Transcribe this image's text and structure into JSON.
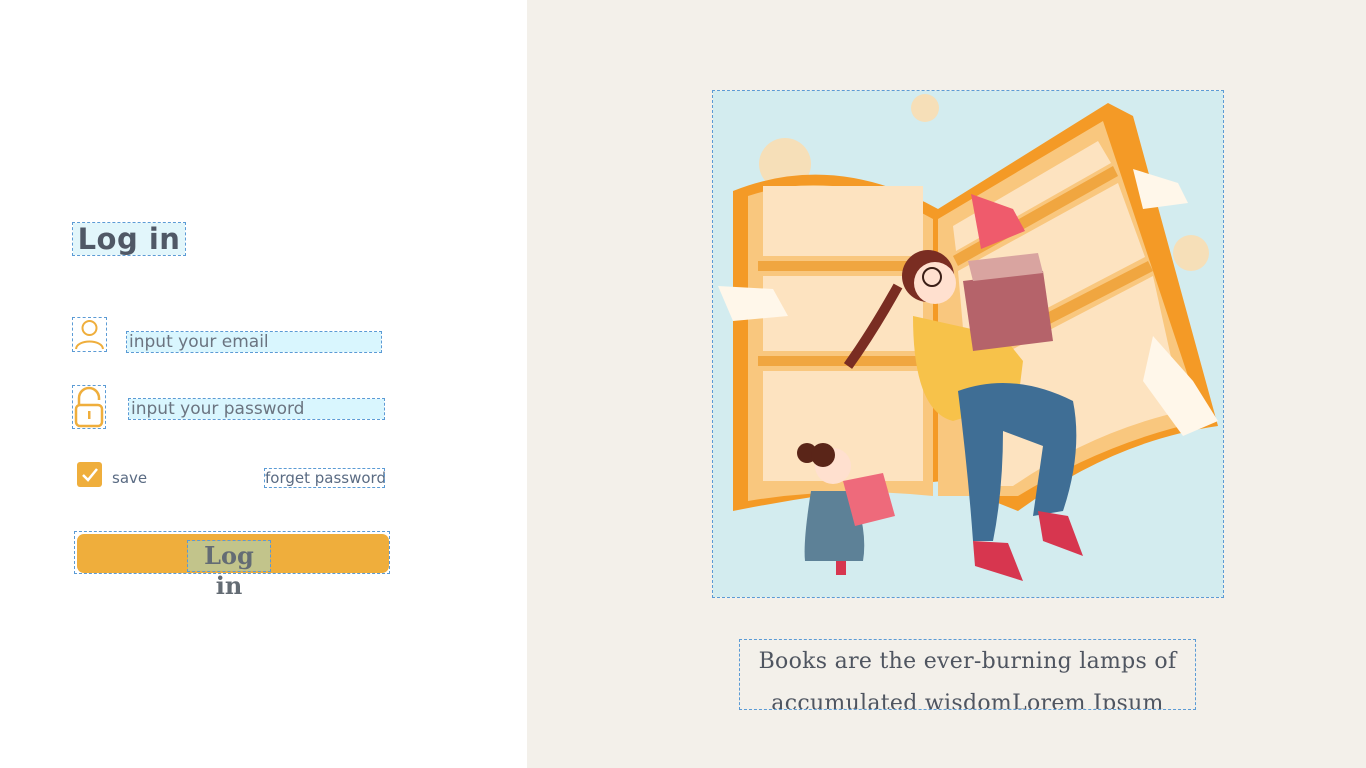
{
  "login": {
    "title": "Log in",
    "email_placeholder": "input your email",
    "password_placeholder": "input your password",
    "save_label": "save",
    "save_checked": true,
    "forget_password_label": "forget password",
    "login_button_label": "Log in"
  },
  "quote": {
    "line1": "Books are the ever-burning lamps of",
    "line2": "accumulated wisdomLorem Ipsum"
  },
  "icons": {
    "user": "user-icon",
    "lock": "lock-icon",
    "check": "check-icon"
  },
  "colors": {
    "accent": "#efae3c",
    "right_background": "#f3f0ea",
    "illustration_background": "#d3ecef",
    "field_background": "#d9f6fe"
  }
}
